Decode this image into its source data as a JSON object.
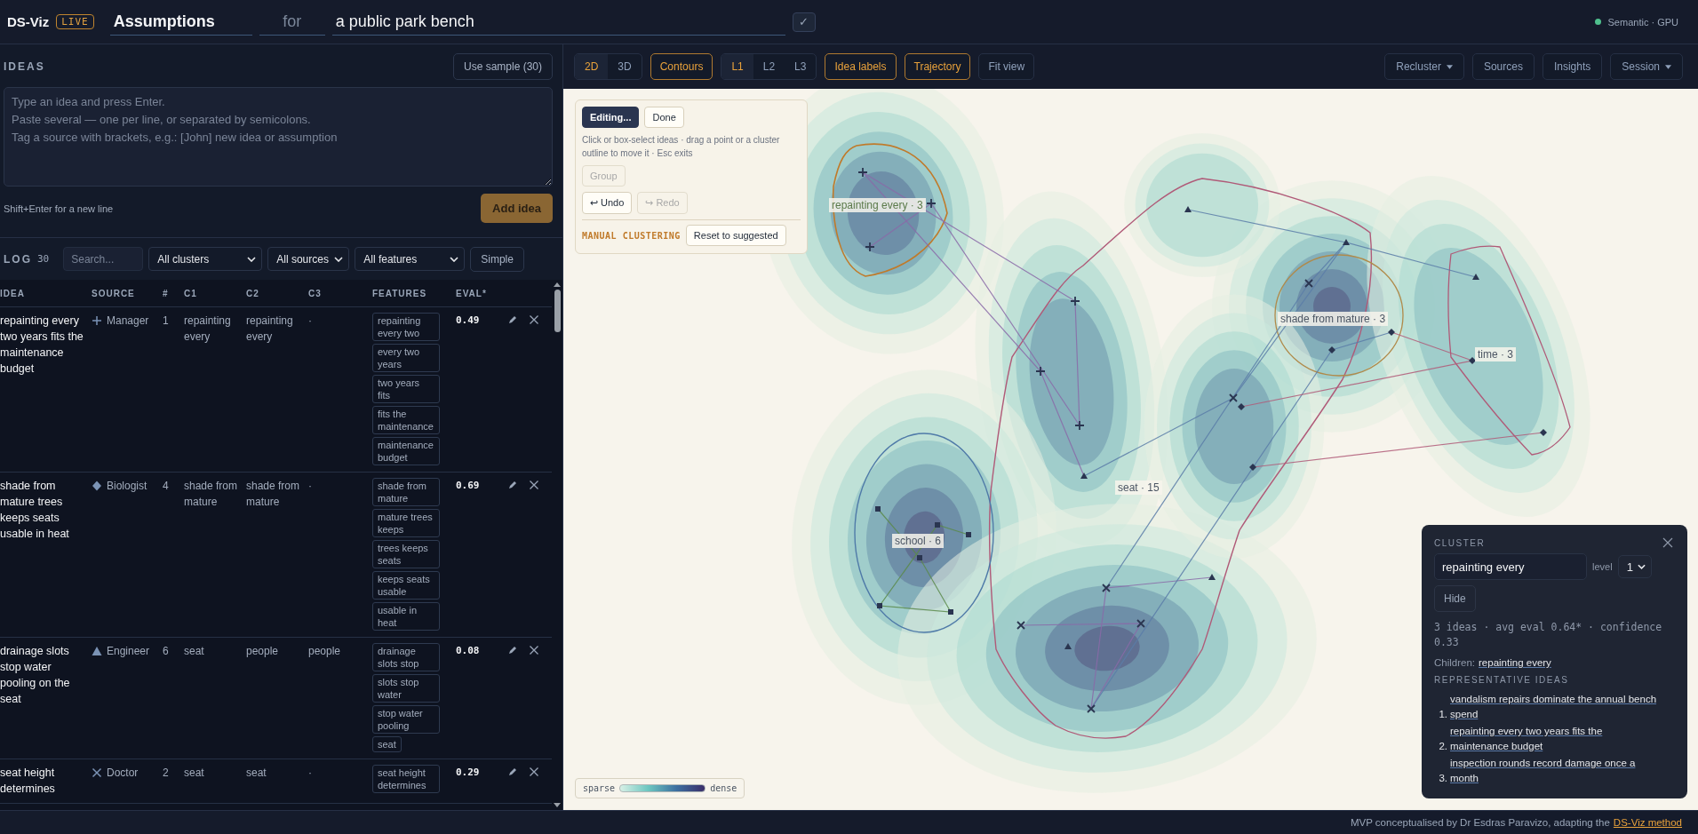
{
  "top_bar": {
    "brand": "DS-Viz",
    "badge": "LIVE",
    "title_field": {
      "value": "Assumptions"
    },
    "connector_field": {
      "value": "for"
    },
    "subject_field": {
      "value": "a public park bench"
    },
    "confirm_button": "✓",
    "status": {
      "label": "Semantic · GPU",
      "active": true
    }
  },
  "ideas": {
    "heading": "IDEAS",
    "sample_button": "Use sample (30)",
    "input": {
      "placeholder": "Type an idea and press Enter.\nPaste several — one per line, or separated by semicolons.\nTag a source with brackets, e.g.: [John] new idea or assumption"
    },
    "hint": "Shift+Enter for a new line",
    "add_button": "Add idea"
  },
  "log": {
    "heading": "LOG",
    "count": "30",
    "search": {
      "placeholder": "Search..."
    },
    "filters": [
      "All clusters",
      "All sources",
      "All features"
    ],
    "mode_button": "Simple",
    "columns": [
      "IDEA",
      "SOURCE",
      "#",
      "C1",
      "C2",
      "C3",
      "FEATURES",
      "EVAL*"
    ],
    "rows": [
      {
        "idea": "repainting every two years fits the maintenance budget",
        "source": "Manager",
        "kind": "plus",
        "number": "1",
        "c1": "repainting every",
        "c2": "repainting every",
        "c3": "·",
        "features": [
          "repainting every two",
          "every two years",
          "two years fits",
          "fits the maintenance",
          "maintenance budget"
        ],
        "eval": "0.49"
      },
      {
        "idea": "shade from mature trees keeps seats usable in heat",
        "source": "Biologist",
        "kind": "diamond",
        "number": "4",
        "c1": "shade from mature",
        "c2": "shade from mature",
        "c3": "·",
        "features": [
          "shade from mature",
          "mature trees keeps",
          "trees keeps seats",
          "keeps seats usable",
          "usable in heat"
        ],
        "eval": "0.69"
      },
      {
        "idea": "drainage slots stop water pooling on the seat",
        "source": "Engineer",
        "kind": "triangle",
        "number": "6",
        "c1": "seat",
        "c2": "people",
        "c3": "people",
        "features": [
          "drainage slots stop",
          "slots stop water",
          "stop water pooling",
          "seat"
        ],
        "eval": "0.08"
      },
      {
        "idea": "seat height determines",
        "source": "Doctor",
        "kind": "cross",
        "number": "2",
        "c1": "seat",
        "c2": "seat",
        "c3": "·",
        "features": [
          "seat height determines"
        ],
        "eval": "0.29"
      }
    ]
  },
  "toolbar": {
    "left": [
      {
        "kind": "segmented",
        "options": [
          {
            "label": "2D",
            "selected": true
          },
          {
            "label": "3D",
            "selected": false
          }
        ]
      },
      {
        "kind": "toggle",
        "label": "Contours",
        "on": true
      },
      {
        "kind": "segmented",
        "options": [
          {
            "label": "L1",
            "selected": true
          },
          {
            "label": "L2",
            "selected": false
          },
          {
            "label": "L3",
            "selected": false
          }
        ]
      },
      {
        "kind": "toggle",
        "label": "Idea labels",
        "on": true
      },
      {
        "kind": "toggle",
        "label": "Trajectory",
        "on": true
      },
      {
        "kind": "button",
        "label": "Fit view"
      }
    ],
    "right": [
      {
        "label": "Recluster",
        "dropdown": true
      },
      {
        "label": "Sources",
        "dropdown": false
      },
      {
        "label": "Insights",
        "dropdown": false
      },
      {
        "label": "Session",
        "dropdown": true
      }
    ]
  },
  "edit_panel": {
    "mode_button": {
      "label": "Editing...",
      "selected": true
    },
    "done_button": "Done",
    "hint": "Click or box-select ideas · drag a point or a cluster outline to move it · Esc exits",
    "group_button": {
      "label": "Group",
      "disabled": true
    },
    "undo_button": {
      "label": "↩ Undo",
      "disabled": false
    },
    "redo_button": {
      "label": "↪ Redo",
      "disabled": true
    },
    "mode_label": "MANUAL CLUSTERING",
    "reset_button": "Reset to suggested"
  },
  "map": {
    "cluster_labels": [
      {
        "text": "repainting every · 3",
        "selected": true
      },
      {
        "text": "shade from mature · 3",
        "selected": false
      },
      {
        "text": "time · 3",
        "selected": false
      },
      {
        "text": "seat · 15",
        "selected": false
      },
      {
        "text": "school · 6",
        "selected": false
      }
    ],
    "legend": {
      "low": "sparse",
      "high": "dense"
    }
  },
  "cluster_panel": {
    "heading": "CLUSTER",
    "name_field": {
      "value": "repainting every"
    },
    "level_label": "level",
    "level_select": "1",
    "hide_button": "Hide",
    "stats": "3 ideas · avg eval 0.64* · confidence 0.33",
    "children_label": "Children:",
    "children": [
      "repainting every"
    ],
    "reps_heading": "REPRESENTATIVE IDEAS",
    "reps": [
      {
        "number": "1.",
        "text": "vandalism repairs dominate the annual bench spend"
      },
      {
        "number": "2.",
        "text": "repainting every two years fits the maintenance budget"
      },
      {
        "number": "3.",
        "text": "inspection rounds record damage once a month"
      }
    ]
  },
  "footer": {
    "text": "MVP conceptualised by Dr Esdras Paravizo, adapting the",
    "link": "DS-Viz method"
  }
}
